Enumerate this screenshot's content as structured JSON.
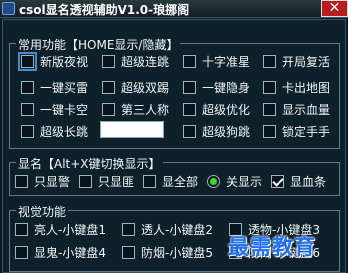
{
  "window": {
    "title": "csol显名透视辅助V1.0-琅挪阁",
    "close_glyph": "✕"
  },
  "groups": {
    "common": {
      "legend": "常用功能【HOME显示/隐藏】",
      "options": [
        {
          "label": "新版夜视",
          "checked": false,
          "focused": true
        },
        {
          "label": "超级连跳",
          "checked": false
        },
        {
          "label": "十字准星",
          "checked": false
        },
        {
          "label": "开局复活",
          "checked": false
        },
        {
          "label": "一键买雷",
          "checked": false
        },
        {
          "label": "超级双踢",
          "checked": false
        },
        {
          "label": "一键隐身",
          "checked": false
        },
        {
          "label": "卡出地图",
          "checked": false
        },
        {
          "label": "一键卡空",
          "checked": false
        },
        {
          "label": "第三人称",
          "checked": false
        },
        {
          "label": "超级优化",
          "checked": false
        },
        {
          "label": "显示血量",
          "checked": false
        },
        {
          "label": "超级长跳",
          "checked": false
        },
        {
          "label": "超级狗跳",
          "checked": false
        },
        {
          "label": "锁定手手",
          "checked": false
        }
      ],
      "long_jump_value": ""
    },
    "name": {
      "legend": "显名【Alt+X键切换显示】",
      "options": [
        {
          "label": "只显警",
          "type": "checkbox",
          "checked": false
        },
        {
          "label": "只显匪",
          "type": "checkbox",
          "checked": false
        },
        {
          "label": "显全部",
          "type": "checkbox",
          "checked": false
        },
        {
          "label": "关显示",
          "type": "radio",
          "checked": true
        },
        {
          "label": "显血条",
          "type": "checkbox",
          "checked": true
        }
      ]
    },
    "vision": {
      "legend": "视觉功能",
      "options": [
        {
          "label": "亮人-小键盘1",
          "checked": false
        },
        {
          "label": "透人-小键盘2",
          "checked": false
        },
        {
          "label": "透物-小键盘3",
          "checked": false
        },
        {
          "label": "显鬼-小键盘4",
          "checked": false
        },
        {
          "label": "防烟-小键盘5",
          "checked": false
        },
        {
          "label": "防闪-小键盘6",
          "checked": false
        }
      ]
    }
  },
  "watermark": "最需教育",
  "colors": {
    "background": "#0e2029",
    "close_button": "#b81d1d",
    "radio_checked": "#2ee02e",
    "watermark": "#1f6ff0"
  }
}
